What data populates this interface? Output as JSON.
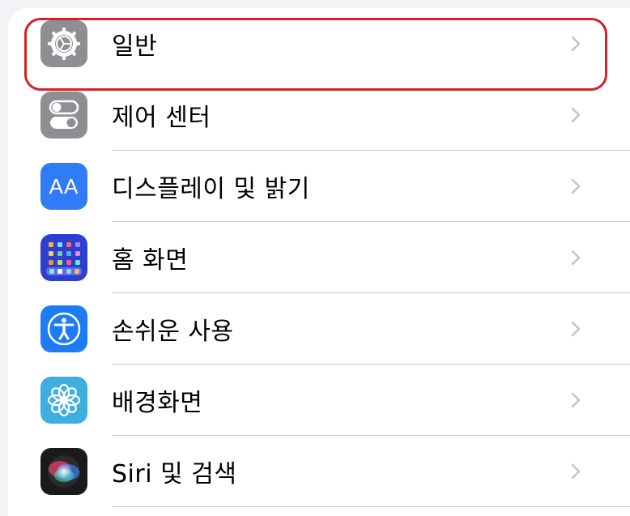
{
  "settings": {
    "items": [
      {
        "label": "일반",
        "icon": "gear-icon",
        "color": "#8e8e93"
      },
      {
        "label": "제어 센터",
        "icon": "toggles-icon",
        "color": "#8e8e93"
      },
      {
        "label": "디스플레이 및 밝기",
        "icon": "text-size-icon",
        "color": "#2f7cf6"
      },
      {
        "label": "홈 화면",
        "icon": "app-grid-icon",
        "color": "#2c3fd0"
      },
      {
        "label": "손쉬운 사용",
        "icon": "accessibility-icon",
        "color": "#1e7cf2"
      },
      {
        "label": "배경화면",
        "icon": "flower-icon",
        "color": "#3eaee0"
      },
      {
        "label": "Siri 및 검색",
        "icon": "siri-icon",
        "color": "#1a1a1a"
      }
    ],
    "highlight_color": "#d6202a",
    "chevron_color": "#c4c4c7"
  },
  "icon_text": {
    "display": "AA"
  }
}
